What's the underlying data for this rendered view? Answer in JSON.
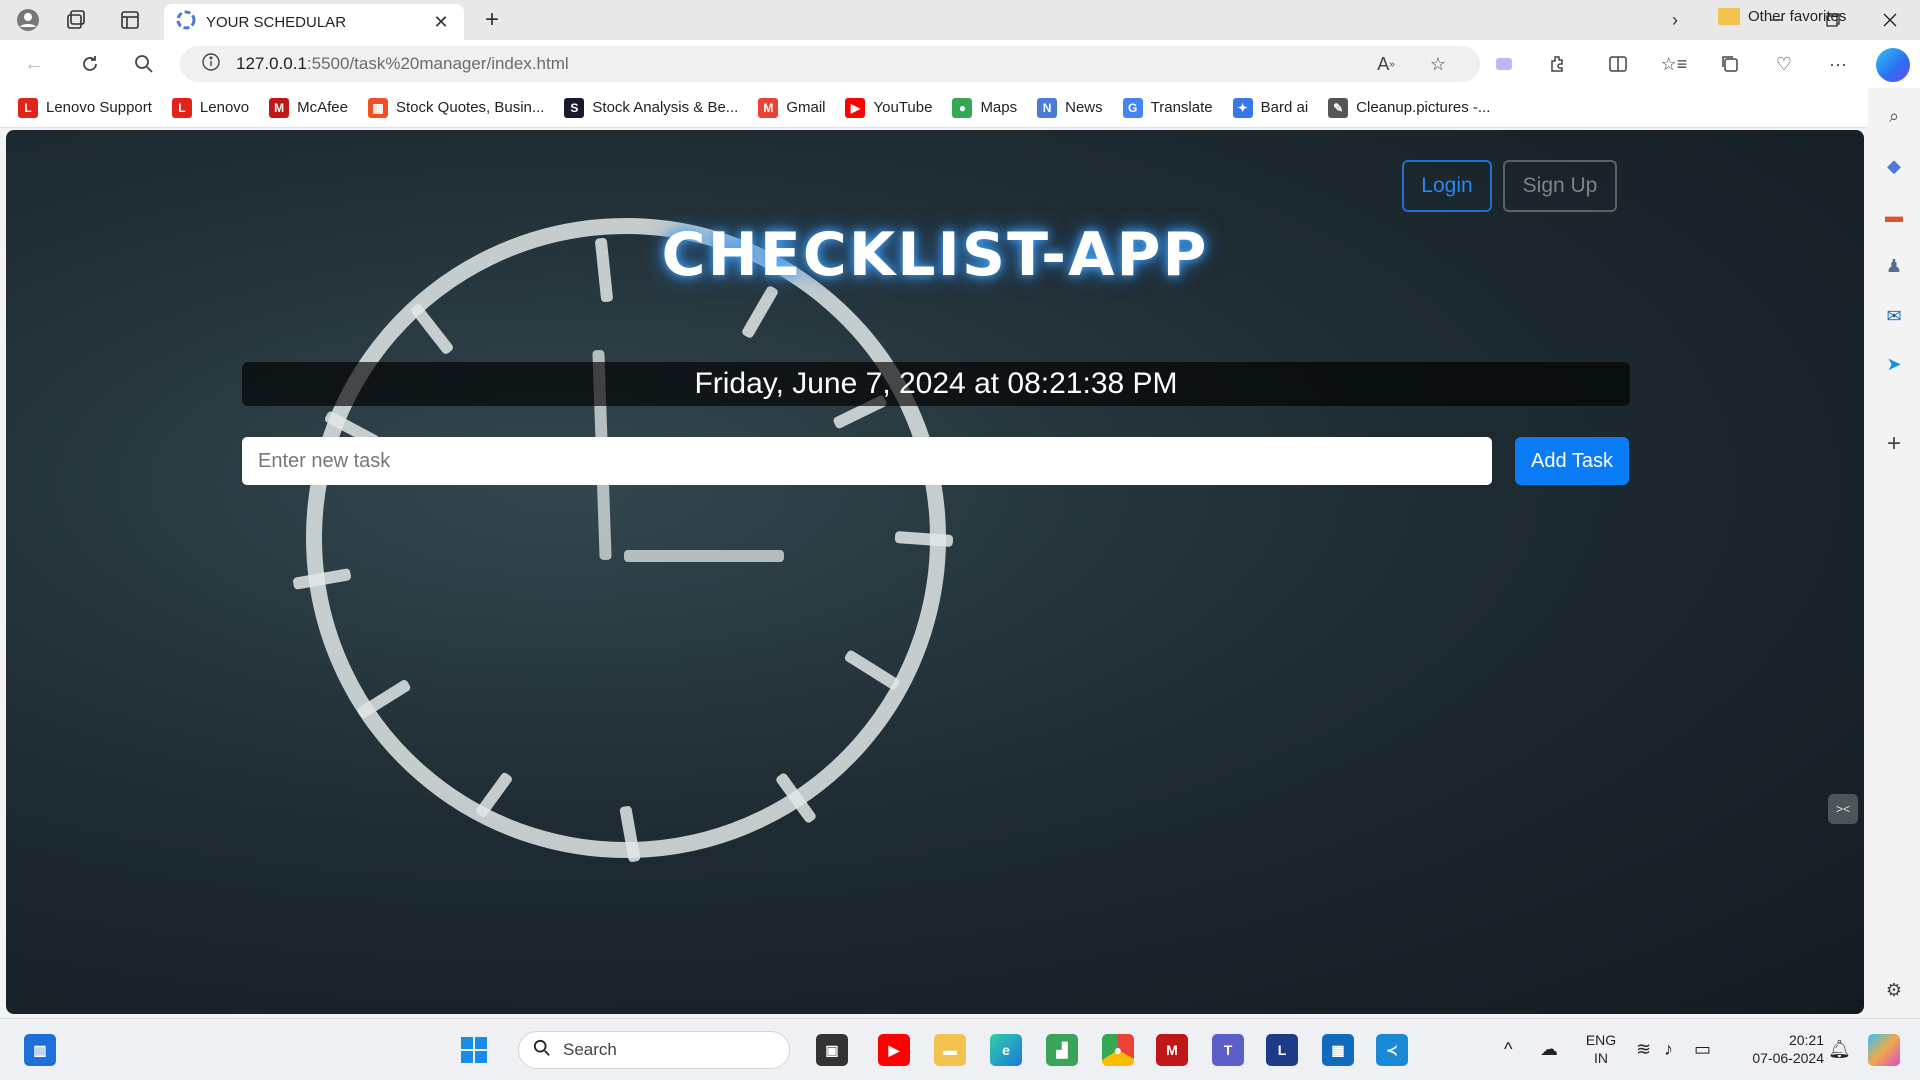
{
  "browser": {
    "tab_title": "YOUR SCHEDULAR",
    "tab_close": "✕",
    "new_tab": "+",
    "url_host": "127.0.0.1",
    "url_path": ":5500/task%20manager/index.html"
  },
  "bookmarks": [
    {
      "label": "Lenovo Support",
      "icon": "lenovo-icon",
      "color": "#e2231a",
      "glyph": "L"
    },
    {
      "label": "Lenovo",
      "icon": "lenovo-icon",
      "color": "#e2231a",
      "glyph": "L"
    },
    {
      "label": "McAfee",
      "icon": "mcafee-icon",
      "color": "#c01818",
      "glyph": "M"
    },
    {
      "label": "Stock Quotes, Busin...",
      "icon": "msn-icon",
      "color": "#f25022",
      "glyph": "▦"
    },
    {
      "label": "Stock Analysis & Be...",
      "icon": "stock-analysis-icon",
      "color": "#1a1a2e",
      "glyph": "S"
    },
    {
      "label": "Gmail",
      "icon": "gmail-icon",
      "color": "#ea4335",
      "glyph": "M"
    },
    {
      "label": "YouTube",
      "icon": "youtube-icon",
      "color": "#ff0000",
      "glyph": "▶"
    },
    {
      "label": "Maps",
      "icon": "maps-icon",
      "color": "#34a853",
      "glyph": "●"
    },
    {
      "label": "News",
      "icon": "news-icon",
      "color": "#4a7bd8",
      "glyph": "N"
    },
    {
      "label": "Translate",
      "icon": "translate-icon",
      "color": "#4285f4",
      "glyph": "G"
    },
    {
      "label": "Bard ai",
      "icon": "bard-icon",
      "color": "#3b78e7",
      "glyph": "✦"
    },
    {
      "label": "Cleanup.pictures -...",
      "icon": "cleanup-icon",
      "color": "#555555",
      "glyph": "✎"
    }
  ],
  "other_favorites": "Other favorites",
  "page": {
    "login_label": "Login",
    "signup_label": "Sign Up",
    "title": "CHECKLIST-APP",
    "datetime": "Friday, June 7, 2024 at 08:21:38 PM",
    "task_placeholder": "Enter new task",
    "add_task_label": "Add Task"
  },
  "taskbar": {
    "search_label": "Search",
    "lang_top": "ENG",
    "lang_bottom": "IN",
    "time": "20:21",
    "date": "07-06-2024"
  },
  "colors": {
    "accent": "#0a7cf5",
    "login_border": "#1d6fd6"
  }
}
